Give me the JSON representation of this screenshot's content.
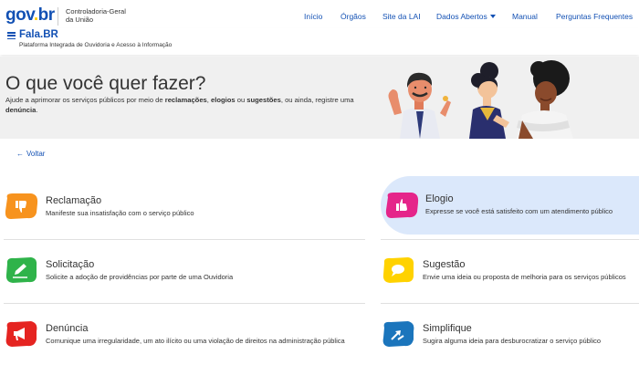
{
  "header": {
    "logo": {
      "part1": "gov",
      "part2": ".",
      "part3": "br"
    },
    "org_line1": "Controladoria-Geral",
    "org_line2": "da União",
    "nav": [
      {
        "label": "Início"
      },
      {
        "label": "Órgãos"
      },
      {
        "label": "Site da LAI"
      },
      {
        "label": "Dados Abertos"
      },
      {
        "label": "Manual"
      },
      {
        "label": "Perguntas Frequentes"
      }
    ]
  },
  "app": {
    "title": "Fala.BR",
    "subtitle": "Plataforma Integrada de Ouvidoria e Acesso à Informação"
  },
  "banner": {
    "heading": "O que você quer fazer?",
    "text_1": "Ajude a aprimorar os serviços públicos por meio de ",
    "bold_1": "reclamações",
    "text_2": ", ",
    "bold_2": "elogios",
    "text_3": " ou ",
    "bold_3": "sugestões",
    "text_4": ", ou ainda, registre uma ",
    "bold_4": "denúncia",
    "text_5": "."
  },
  "back_link": {
    "arrow": "←",
    "label": "Voltar"
  },
  "options": [
    {
      "title": "Reclamação",
      "description": "Manifeste sua insatisfação com o serviço público",
      "color": "#f7931e",
      "icon": "thumbs-down-icon"
    },
    {
      "title": "Elogio",
      "description": "Expresse se você está satisfeito com um atendimento público",
      "color": "#e5258a",
      "icon": "thumbs-up-icon"
    },
    {
      "title": "Solicitação",
      "description": "Solicite a adoção de providências por parte de uma Ouvidoria",
      "color": "#2fb34a",
      "icon": "pencil-icon"
    },
    {
      "title": "Sugestão",
      "description": "Envie uma ideia ou proposta de melhoria para os serviços públicos",
      "color": "#ffd200",
      "icon": "speech-bubble-icon"
    },
    {
      "title": "Denúncia",
      "description": "Comunique uma irregularidade, um ato ilícito ou uma violação de direitos na administração pública",
      "color": "#e52421",
      "icon": "megaphone-icon"
    },
    {
      "title": "Simplifique",
      "description": "Sugira alguma ideia para desburocratizar o serviço público",
      "color": "#1b75bc",
      "icon": "arrows-icon"
    }
  ],
  "colors": {
    "primary": "#1351b4",
    "highlight": "#dbe8fb",
    "banner_bg": "#f0f0f0"
  }
}
